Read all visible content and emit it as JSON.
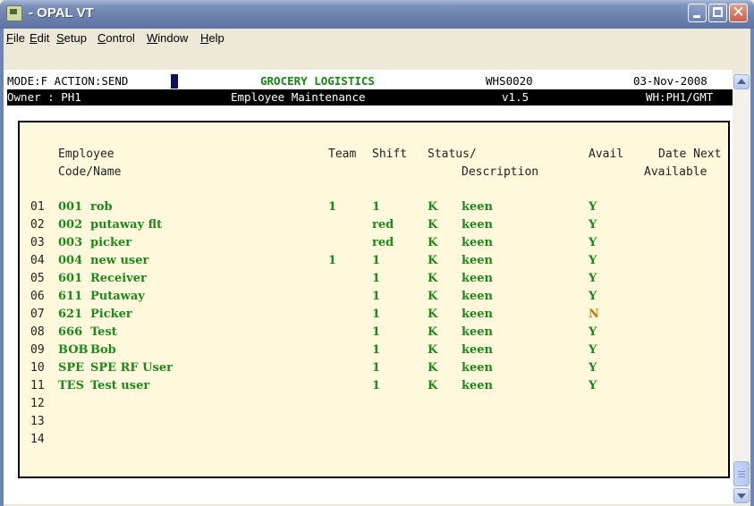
{
  "window": {
    "title": "- OPAL VT"
  },
  "menu": [
    {
      "label": "File",
      "underline": "F",
      "rest": "ile"
    },
    {
      "label": "Edit",
      "underline": "E",
      "rest": "dit"
    },
    {
      "label": "Setup",
      "underline": "S",
      "rest": "etup"
    },
    {
      "label": "Control",
      "underline": "C",
      "rest": "ontrol"
    },
    {
      "label": "Window",
      "underline": "W",
      "rest": "indow"
    },
    {
      "label": "Help",
      "underline": "H",
      "rest": "elp"
    }
  ],
  "header": {
    "mode": "MODE:F ACTION:SEND",
    "company": "GROCERY LOGISTICS",
    "program": "WHS0020",
    "date": "03-Nov-2008",
    "owner": "Owner : PH1",
    "screen": "Employee Maintenance",
    "version": "v1.5",
    "warehouse": "WH:PH1/GMT"
  },
  "columns": {
    "employee_l1": "Employee",
    "employee_l2": "Code/Name",
    "team": "Team",
    "shift": "Shift",
    "status_l1": "Status/",
    "status_l2": "Description",
    "avail": "Avail",
    "date_next_l1": "Date Next",
    "date_next_l2": "Available"
  },
  "rows": [
    {
      "num": "01",
      "code": "001",
      "name": "rob",
      "team": "1",
      "shift": "1",
      "status": "K",
      "desc": "keen",
      "avail": "Y"
    },
    {
      "num": "02",
      "code": "002",
      "name": "putaway flt",
      "team": "",
      "shift": "red",
      "status": "K",
      "desc": "keen",
      "avail": "Y"
    },
    {
      "num": "03",
      "code": "003",
      "name": "picker",
      "team": "",
      "shift": "red",
      "status": "K",
      "desc": "keen",
      "avail": "Y"
    },
    {
      "num": "04",
      "code": "004",
      "name": "new user",
      "team": "1",
      "shift": "1",
      "status": "K",
      "desc": "keen",
      "avail": "Y"
    },
    {
      "num": "05",
      "code": "601",
      "name": "Receiver",
      "team": "",
      "shift": "1",
      "status": "K",
      "desc": "keen",
      "avail": "Y"
    },
    {
      "num": "06",
      "code": "611",
      "name": "Putaway",
      "team": "",
      "shift": "1",
      "status": "K",
      "desc": "keen",
      "avail": "Y"
    },
    {
      "num": "07",
      "code": "621",
      "name": "Picker",
      "team": "",
      "shift": "1",
      "status": "K",
      "desc": "keen",
      "avail": "N"
    },
    {
      "num": "08",
      "code": "666",
      "name": "Test",
      "team": "",
      "shift": "1",
      "status": "K",
      "desc": "keen",
      "avail": "Y"
    },
    {
      "num": "09",
      "code": "BOB",
      "name": "Bob",
      "team": "",
      "shift": "1",
      "status": "K",
      "desc": "keen",
      "avail": "Y"
    },
    {
      "num": "10",
      "code": "SPE",
      "name": "SPE RF User",
      "team": "",
      "shift": "1",
      "status": "K",
      "desc": "keen",
      "avail": "Y"
    },
    {
      "num": "11",
      "code": "TES",
      "name": "Test user",
      "team": "",
      "shift": "1",
      "status": "K",
      "desc": "keen",
      "avail": "Y"
    },
    {
      "num": "12",
      "code": "",
      "name": "",
      "team": "",
      "shift": "",
      "status": "",
      "desc": "",
      "avail": ""
    },
    {
      "num": "13",
      "code": "",
      "name": "",
      "team": "",
      "shift": "",
      "status": "",
      "desc": "",
      "avail": ""
    },
    {
      "num": "14",
      "code": "",
      "name": "",
      "team": "",
      "shift": "",
      "status": "",
      "desc": "",
      "avail": ""
    }
  ],
  "colors": {
    "field_green": "#1a8a1a",
    "avail_no": "#c87800",
    "panel_bg": "#fff8dc"
  }
}
